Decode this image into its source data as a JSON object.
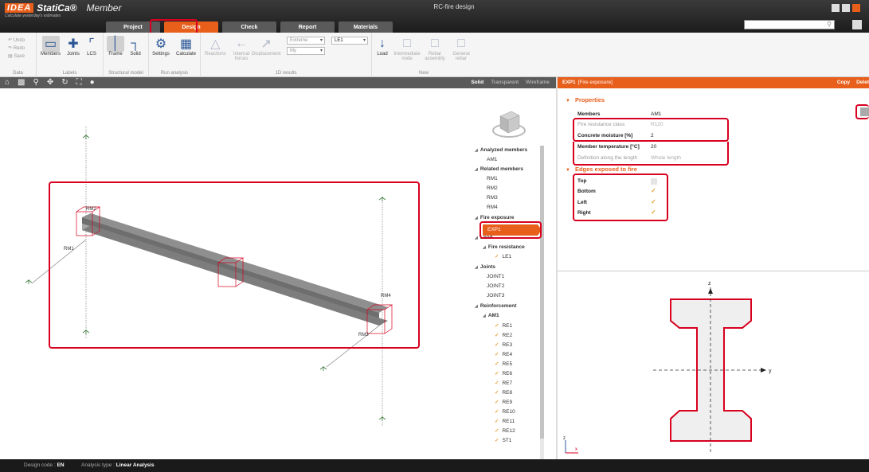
{
  "app": {
    "brand": "IDEA",
    "product_name": "StatiCa®",
    "module": "Member",
    "tagline": "Calculate yesterday's estimates",
    "window_title": "RC-fire design"
  },
  "tabs": [
    {
      "label": "Project",
      "active": false
    },
    {
      "label": "Design",
      "active": true
    },
    {
      "label": "Check",
      "active": false
    },
    {
      "label": "Report",
      "active": false
    },
    {
      "label": "Materials",
      "active": false
    }
  ],
  "ribbon": {
    "data": {
      "undo": "Undo",
      "redo": "Redo",
      "save": "Save",
      "group": "Data"
    },
    "labels": {
      "members": "Members",
      "joints": "Joints",
      "lcs": "LCS",
      "group": "Labels"
    },
    "structural_model": {
      "frame": "Frame",
      "solid": "Solid",
      "group": "Structural model"
    },
    "run_analysis": {
      "settings": "Settings",
      "calculate": "Calculate",
      "group": "Run analysis"
    },
    "results_1d": {
      "reactions": "Reactions",
      "internal_forces": "Internal forces",
      "displacement": "Displacement",
      "extreme": "Extreme",
      "my": "My",
      "le1": "LE1",
      "group": "1D results"
    },
    "new": {
      "load": "Load",
      "intermediate_node": "Intermediate node",
      "rebar_assembly": "Rebar assembly",
      "general_rebar": "General rebar",
      "group": "New"
    }
  },
  "viewport": {
    "modes": [
      "Solid",
      "Transparent",
      "Wireframe"
    ],
    "active_mode": "Solid",
    "labels": {
      "rm1": "RM1",
      "rm2": "RM2",
      "rm3": "RM3",
      "rm4": "RM4"
    }
  },
  "tree": {
    "analyzed_members": "Analyzed members",
    "am1": "AM1",
    "related_members": "Related members",
    "related": [
      "RM1",
      "RM2",
      "RM3",
      "RM4"
    ],
    "fire_exposure": "Fire exposure",
    "exp1": "EXP1",
    "load": "Load",
    "fire_resistance": "Fire resistance",
    "le1": "LE1",
    "joints": "Joints",
    "joint_items": [
      "JOINT1",
      "JOINT2",
      "JOINT3"
    ],
    "reinforcement": "Reinforcement",
    "am1_group": "AM1",
    "rebars": [
      "RE1",
      "RE2",
      "RE3",
      "RE4",
      "RE5",
      "RE6",
      "RE7",
      "RE8",
      "RE9",
      "RE10",
      "RE11",
      "RE12",
      "ST1"
    ]
  },
  "properties": {
    "header_id": "EXP1",
    "header_type": "[Fire exposure]",
    "copy": "Copy",
    "delete": "Delet",
    "section_properties": "Properties",
    "members_label": "Members",
    "members_value": "AM1",
    "fire_class_label": "Fire resistance class",
    "fire_class_value": "R120",
    "moisture_label": "Concrete moisture [%]",
    "moisture_value": "2",
    "temperature_label": "Member temperature [°C]",
    "temperature_value": "20",
    "definition_label": "Definition along the length",
    "definition_value": "Whole length",
    "section_edges": "Edges exposed to fire",
    "edges": [
      {
        "label": "Top",
        "checked": false
      },
      {
        "label": "Bottom",
        "checked": true
      },
      {
        "label": "Left",
        "checked": true
      },
      {
        "label": "Right",
        "checked": true
      }
    ]
  },
  "section_view": {
    "axis_z": "z",
    "axis_y": "y",
    "axis_z_small": "z",
    "axis_x_small": "x"
  },
  "status": {
    "design_code_label": "Design code :",
    "design_code": "EN",
    "analysis_type_label": "Analysis type :",
    "analysis_type": "Linear Analysis"
  },
  "colors": {
    "accent": "#e85e1b",
    "highlight": "#d8001f",
    "check": "#e8a33a"
  }
}
